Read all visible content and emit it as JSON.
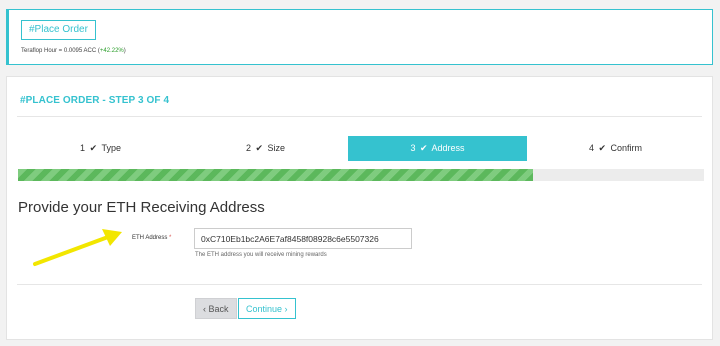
{
  "top": {
    "button_label": "#Place Order",
    "teraflop_text": "Teraflop Hour = 0.0095 ACC (",
    "teraflop_change": "+42.22%",
    "teraflop_close": ")"
  },
  "order": {
    "step_title": "#PLACE ORDER - STEP 3 OF 4",
    "steps": [
      {
        "num": "1",
        "label": "Type",
        "state": "done"
      },
      {
        "num": "2",
        "label": "Size",
        "state": "done"
      },
      {
        "num": "3",
        "label": "Address",
        "state": "active"
      },
      {
        "num": "4",
        "label": "Confirm",
        "state": "pending"
      }
    ],
    "progress_fraction": 0.75,
    "heading": "Provide your ETH Receiving Address",
    "field_label": "ETH Address",
    "required_mark": "*",
    "field_value": "0xC710Eb1bc2A6E7af8458f08928c6e5507326",
    "field_help": "The ETH address you will receive mining rewards",
    "back_label": "‹ Back",
    "continue_label": "Continue ›"
  },
  "colors": {
    "accent": "#35c2cf",
    "progress": "#5cb85c",
    "annotation_arrow": "#f2e600"
  },
  "icons": {
    "step_check": "check-icon",
    "annotation": "arrow-annotation"
  }
}
